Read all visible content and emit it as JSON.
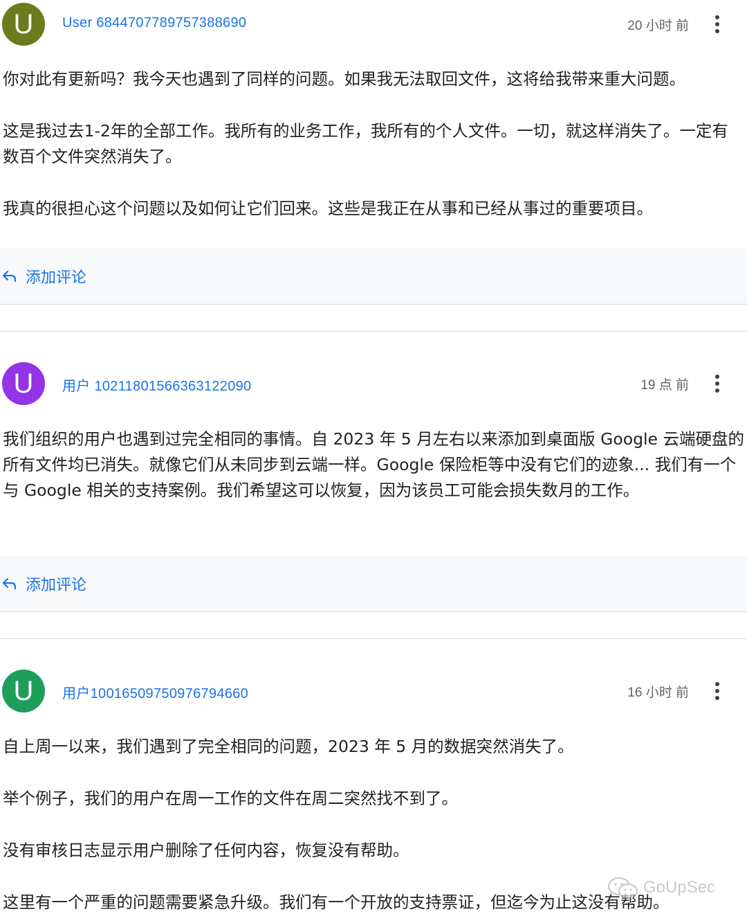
{
  "posts": [
    {
      "avatar_letter": "U",
      "avatar_color": "#6b7b1e",
      "username": "User 6844707789757388690",
      "time": "20 小时 前",
      "paragraphs": [
        "你对此有更新吗？我今天也遇到了同样的问题。如果我无法取回文件，这将给我带来重大问题。",
        "这是我过去1-2年的全部工作。我所有的业务工作，我所有的个人文件。一切，就这样消失了。一定有数百个文件突然消失了。",
        "我真的很担心这个问题以及如何让它们回来。这些是我正在从事和已经从事过的重要项目。"
      ],
      "comment_label": "添加评论"
    },
    {
      "avatar_letter": "U",
      "avatar_color": "#9334e6",
      "username": "用户 10211801566363122090",
      "time": "19 点 前",
      "paragraphs": [
        "我们组织的用户也遇到过完全相同的事情。自 2023 年 5 月左右以来添加到桌面版 Google 云端硬盘的所有文件均已消失。就像它们从未同步到云端一样。Google 保险柜等中没有它们的迹象... 我们有一个与 Google 相关的支持案例。我们希望这可以恢复，因为该员工可能会损失数月的工作。"
      ],
      "comment_label": "添加评论"
    },
    {
      "avatar_letter": "U",
      "avatar_color": "#1e9e5a",
      "username": "用户10016509750976794660",
      "time": "16 小时 前",
      "paragraphs": [
        "自上周一以来，我们遇到了完全相同的问题，2023 年 5 月的数据突然消失了。",
        "举个例子，我们的用户在周一工作的文件在周二突然找不到了。",
        "没有审核日志显示用户删除了任何内容，恢复没有帮助。",
        "这里有一个严重的问题需要紧急升级。我们有一个开放的支持票证，但迄今为止这没有帮助。"
      ]
    }
  ],
  "watermark": "GoUpSec",
  "colors": {
    "link": "#1a73e8",
    "comment_bar_bg": "#f8f9fa",
    "divider": "#d5d7da"
  }
}
